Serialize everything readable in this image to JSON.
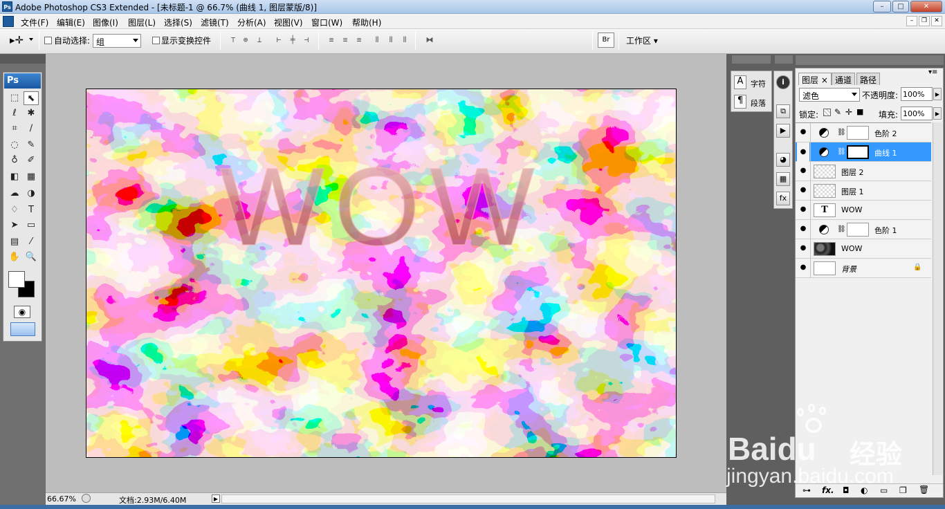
{
  "window": {
    "title": "Adobe Photoshop CS3 Extended - [未标题-1 @ 66.7% (曲线 1, 图层蒙版/8)]",
    "logo": "Ps",
    "buttons": {
      "minimize": "–",
      "maximize": "□",
      "close": "✕"
    }
  },
  "menubar": {
    "items": [
      "文件(F)",
      "编辑(E)",
      "图像(I)",
      "图层(L)",
      "选择(S)",
      "滤镜(T)",
      "分析(A)",
      "视图(V)",
      "窗口(W)",
      "帮助(H)"
    ],
    "doc_buttons": {
      "minimize": "–",
      "restore": "❐",
      "close": "✕"
    }
  },
  "options": {
    "auto_select_label": "自动选择:",
    "auto_select_value": "组",
    "show_transform_label": "显示变换控件",
    "workspace_label": "工作区",
    "workspace_arrow": "▾"
  },
  "toolbox": {
    "badge": "Ps",
    "tools": [
      "⬚",
      "⬉",
      "ℓ",
      "✱",
      "⌗",
      "∕",
      "◌",
      "✎",
      "♁",
      "✐",
      "◧",
      "▦",
      "☁",
      "◑",
      "♢",
      "T",
      "➤",
      "▭",
      "▤",
      "⁄",
      "✋",
      "🔍"
    ]
  },
  "document": {
    "overlay_text": "WOW",
    "zoom": "66.67%",
    "doc_info": "文档:2.93M/6.40M"
  },
  "char_panel": {
    "character_label": "字符",
    "paragraph_label": "段落",
    "character_icon": "A",
    "paragraph_icon": "¶"
  },
  "layers_panel": {
    "tabs": [
      "图层",
      "通道",
      "路径"
    ],
    "blend_mode": "滤色",
    "opacity_label": "不透明度:",
    "opacity_value": "100%",
    "lock_label": "锁定:",
    "fill_label": "填充:",
    "fill_value": "100%",
    "layers": [
      {
        "name": "色阶 2",
        "type": "adjustment",
        "selected": false
      },
      {
        "name": "曲线 1",
        "type": "adjustment",
        "selected": true
      },
      {
        "name": "图层 2",
        "type": "pixel",
        "selected": false
      },
      {
        "name": "图层 1",
        "type": "pixel",
        "selected": false
      },
      {
        "name": "WOW",
        "type": "text",
        "selected": false
      },
      {
        "name": "色阶 1",
        "type": "adjustment",
        "selected": false
      },
      {
        "name": "WOW",
        "type": "texture",
        "selected": false
      },
      {
        "name": "背景",
        "type": "background",
        "selected": false
      }
    ],
    "footer_icons": [
      "link-icon",
      "fx-icon",
      "mask-icon",
      "adjustment-icon",
      "group-icon",
      "new-layer-icon",
      "trash-icon"
    ],
    "footer_glyphs": [
      "⊶",
      "fx.",
      "◘",
      "◐",
      "▭",
      "❐",
      "🗑"
    ]
  },
  "watermark": {
    "brand": "Baidu",
    "brand_cn": "经验",
    "url": "jingyan.baidu.com"
  },
  "colors": {
    "accent_selection": "#3399ff",
    "canvas_pink": "#f2a7a3",
    "canvas_dark": "#000000"
  }
}
